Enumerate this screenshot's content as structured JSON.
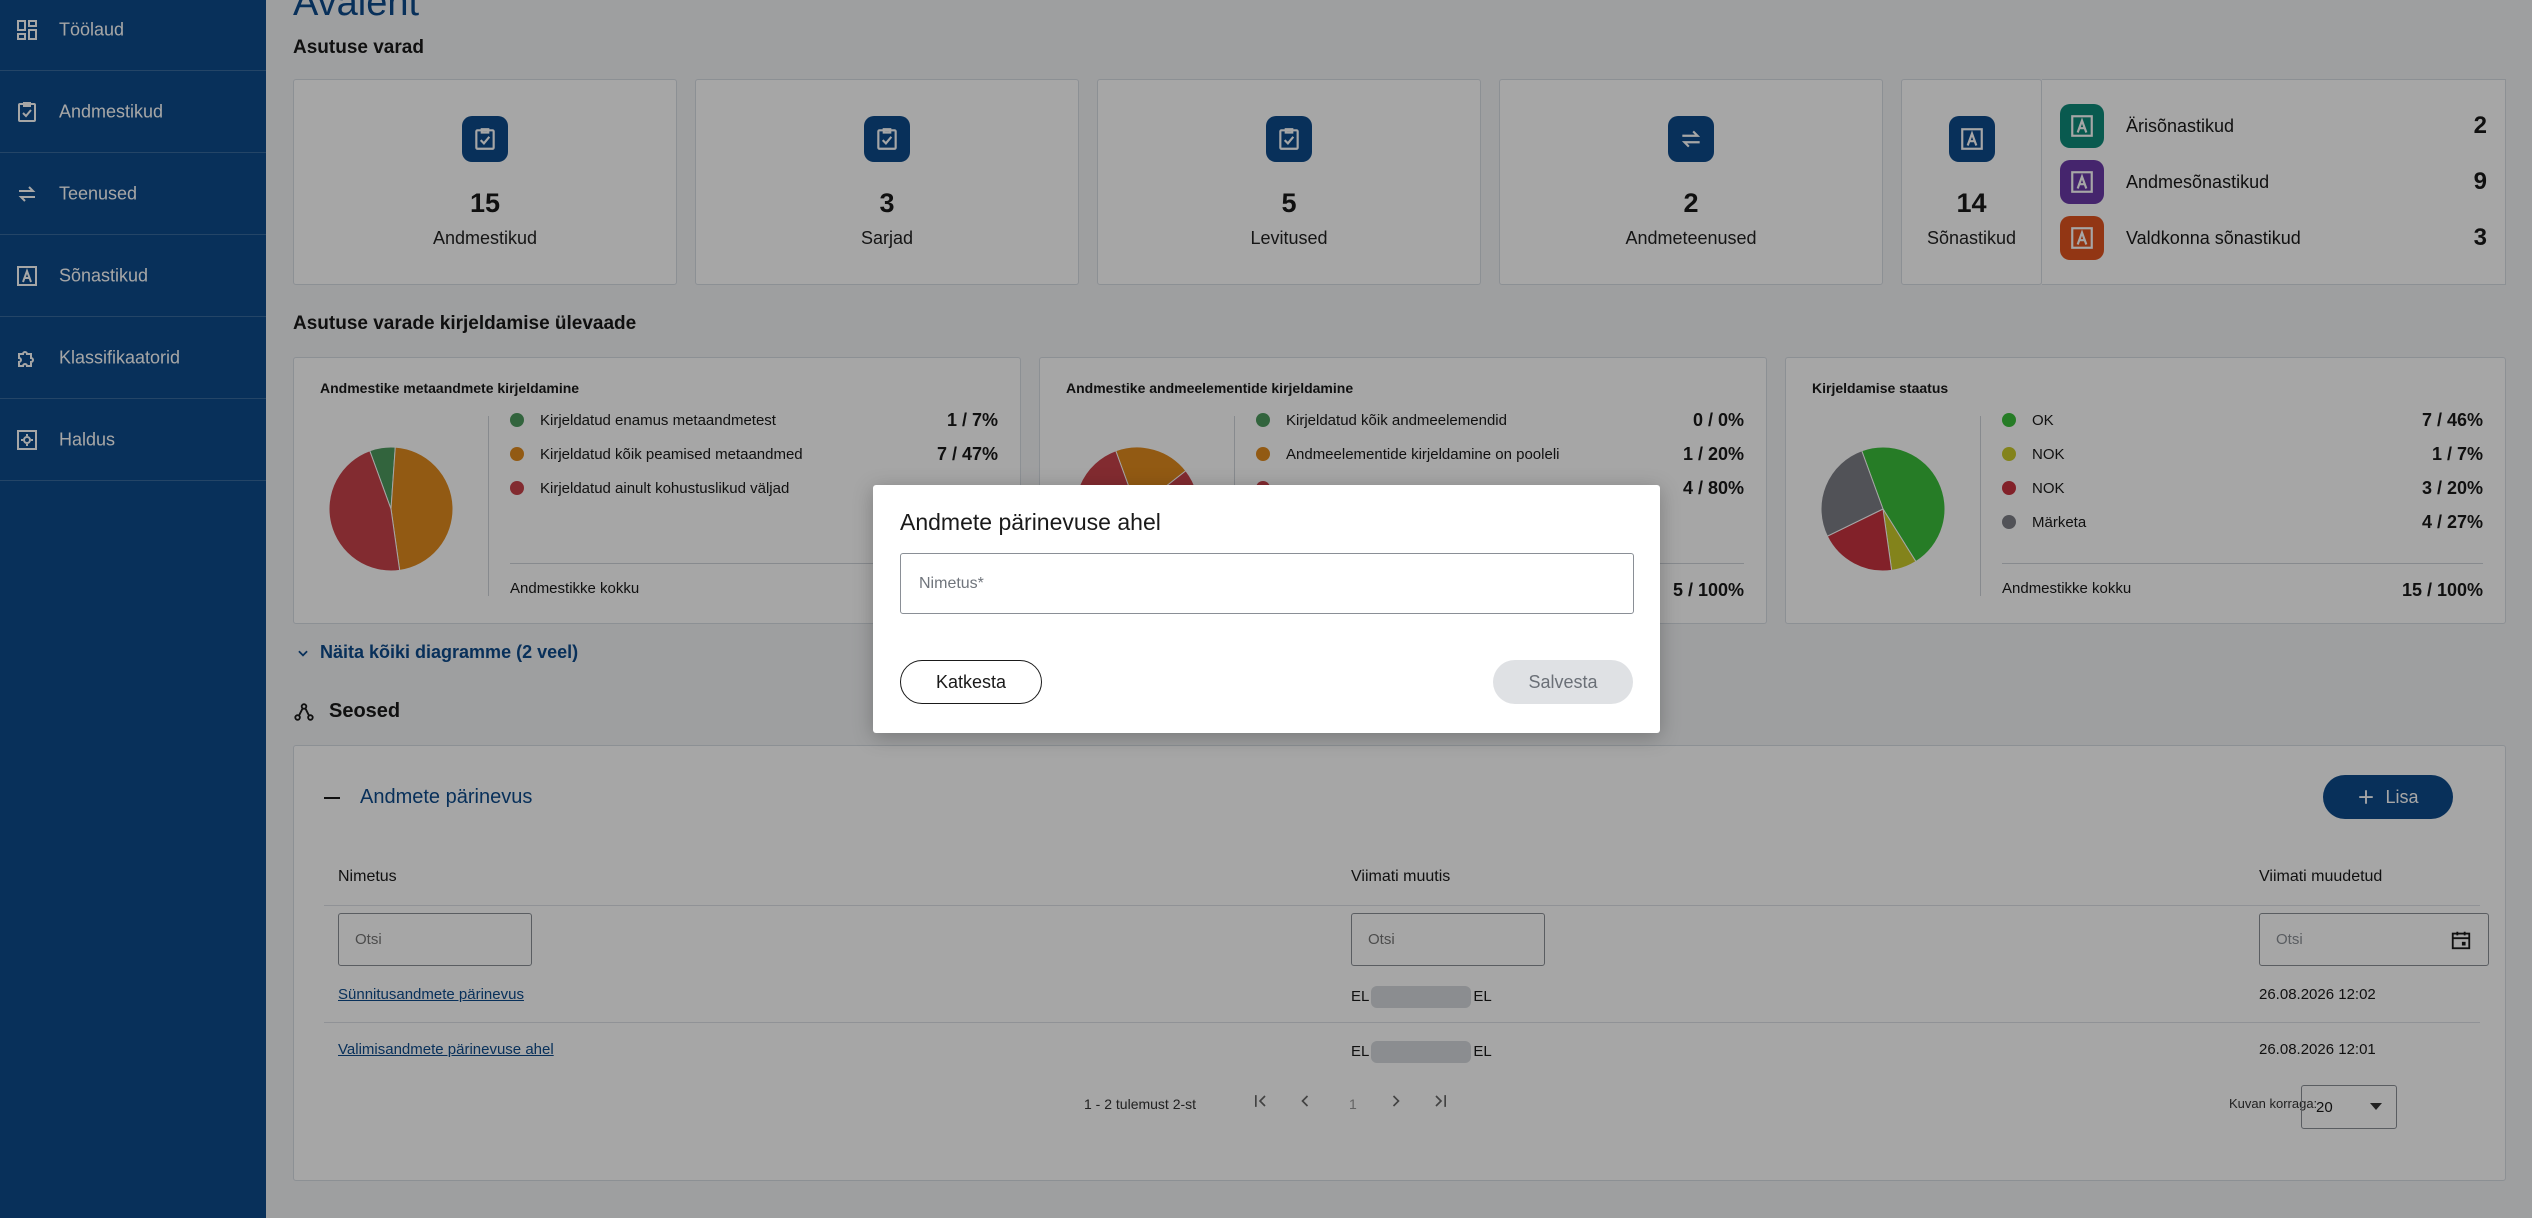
{
  "sidebar": {
    "items": [
      {
        "label": "Töölaud",
        "icon": "dashboard-icon"
      },
      {
        "label": "Andmestikud",
        "icon": "clipboard-check-icon"
      },
      {
        "label": "Teenused",
        "icon": "swap-arrows-icon"
      },
      {
        "label": "Sõnastikud",
        "icon": "dictionary-a-icon"
      },
      {
        "label": "Klassifikaatorid",
        "icon": "puzzle-icon"
      },
      {
        "label": "Haldus",
        "icon": "gear-box-icon"
      }
    ]
  },
  "header": {
    "title": "Avaleht"
  },
  "assets": {
    "title": "Asutuse varad",
    "cards": [
      {
        "count": "15",
        "label": "Andmestikud",
        "icon": "clipboard-check-icon"
      },
      {
        "count": "3",
        "label": "Sarjad",
        "icon": "clipboard-check-icon"
      },
      {
        "count": "5",
        "label": "Levitused",
        "icon": "clipboard-check-icon"
      },
      {
        "count": "2",
        "label": "Andmeteenused",
        "icon": "swap-arrows-icon"
      },
      {
        "count": "14",
        "label": "Sõnastikud",
        "icon": "dictionary-a-icon"
      }
    ],
    "vocabularies": [
      {
        "label": "Ärisõnastikud",
        "count": "2",
        "color": "#0f8a7a"
      },
      {
        "label": "Andmesõnastikud",
        "count": "9",
        "color": "#6a3aa8"
      },
      {
        "label": "Valdkonna sõnastikud",
        "count": "3",
        "color": "#e0531f"
      }
    ]
  },
  "overview": {
    "title": "Asutuse varade kirjeldamise ülevaade",
    "charts": [
      {
        "title": "Andmestike metaandmete kirjeldamine",
        "legend": [
          {
            "label": "Kirjeldatud enamus metaandmetest",
            "value": "1 / 7%",
            "color": "#4e9a5e"
          },
          {
            "label": "Kirjeldatud kõik peamised metaandmed",
            "value": "7 / 47%",
            "color": "#e08a1e"
          },
          {
            "label": "Kirjeldatud ainult kohustuslikud väljad",
            "value": "",
            "color": "#c8434a"
          }
        ],
        "total_label": "Andmestikke kokku",
        "total_value": ""
      },
      {
        "title": "Andmestike andmeelementide kirjeldamine",
        "legend": [
          {
            "label": "Kirjeldatud kõik andmeelemendid",
            "value": "0 / 0%",
            "color": "#4e9a5e"
          },
          {
            "label": "Andmeelementide kirjeldamine on pooleli",
            "value": "1 / 20%",
            "color": "#e08a1e"
          },
          {
            "label": "",
            "value": "4 / 80%",
            "color": "#c8434a"
          }
        ],
        "total_label": "",
        "total_value": "5 / 100%"
      },
      {
        "title": "Kirjeldamise staatus",
        "legend": [
          {
            "label": "OK",
            "value": "7 / 46%",
            "color": "#3bbf3b"
          },
          {
            "label": "NOK",
            "value": "1 / 7%",
            "color": "#c9c92a"
          },
          {
            "label": "NOK",
            "value": "3 / 20%",
            "color": "#c8343f"
          },
          {
            "label": "Märketa",
            "value": "4 / 27%",
            "color": "#7d7f86"
          }
        ],
        "total_label": "Andmestikke kokku",
        "total_value": "15 / 100%"
      }
    ],
    "show_all": "Näita kõiki diagramme (2 veel)"
  },
  "chart_data": [
    {
      "type": "pie",
      "title": "Andmestike metaandmete kirjeldamine",
      "categories": [
        "Kirjeldatud enamus metaandmetest",
        "Kirjeldatud kõik peamised metaandmed",
        "Kirjeldatud ainult kohustuslikud väljad"
      ],
      "values": [
        1,
        7,
        7
      ],
      "colors": [
        "#4e9a5e",
        "#e08a1e",
        "#c8434a"
      ]
    },
    {
      "type": "pie",
      "title": "Andmestike andmeelementide kirjeldamine",
      "categories": [
        "Kirjeldatud kõik andmeelemendid",
        "Andmeelementide kirjeldamine on pooleli",
        ""
      ],
      "values": [
        0,
        1,
        4
      ],
      "colors": [
        "#4e9a5e",
        "#e08a1e",
        "#c8434a"
      ]
    },
    {
      "type": "pie",
      "title": "Kirjeldamise staatus",
      "categories": [
        "OK",
        "NOK",
        "NOK",
        "Märketa"
      ],
      "values": [
        7,
        1,
        3,
        4
      ],
      "colors": [
        "#3bbf3b",
        "#c9c92a",
        "#c8343f",
        "#7d7f86"
      ]
    }
  ],
  "relations": {
    "title": "Seosed",
    "section": "Andmete pärinevus",
    "add_label": "Lisa",
    "columns": [
      "Nimetus",
      "Viimati muutis",
      "Viimati muudetud"
    ],
    "filter_placeholder": "Otsi",
    "rows": [
      {
        "name": "Sünnitusandmete pärinevus",
        "user_start": "EL",
        "user_end": "EL",
        "date": "26.08.2026 12:02"
      },
      {
        "name": "Valimisandmete pärinevuse ahel",
        "user_start": "EL",
        "user_end": "EL",
        "date": "26.08.2026 12:01"
      }
    ],
    "pager_text": "1 - 2 tulemust 2-st",
    "page": "1",
    "rows_per_page_label": "Kuvan korraga:",
    "rows_per_page": "20"
  },
  "modal": {
    "title": "Andmete pärinevuse ahel",
    "input_placeholder": "Nimetus*",
    "cancel_label": "Katkesta",
    "save_label": "Salvesta"
  }
}
